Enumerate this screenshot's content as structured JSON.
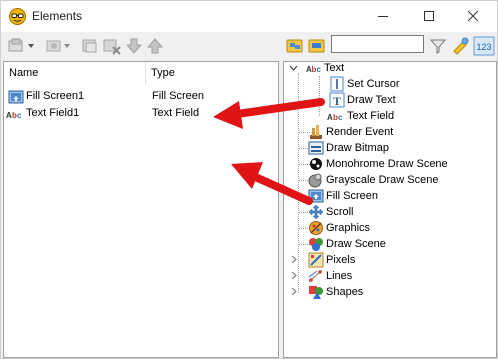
{
  "window": {
    "title": "Elements",
    "controls": {
      "minimize": "minimize",
      "maximize": "maximize",
      "close": "close"
    }
  },
  "toolbar_left": {
    "icons": [
      "add-element-icon",
      "add-dropdown-icon",
      "duplicate-icon",
      "delete-icon",
      "move-down-icon",
      "move-up-icon"
    ]
  },
  "toolbar_right": {
    "search": {
      "value": "",
      "placeholder": ""
    },
    "icons": [
      "expand-all-icon",
      "collapse-all-icon",
      "clear-filter-icon",
      "settings-icon",
      "sort-numeric-icon"
    ]
  },
  "elements_list": {
    "columns": [
      "Name",
      "Type"
    ],
    "rows": [
      {
        "name": "Fill Screen1",
        "type": "Fill Screen",
        "icon": "fill-screen-icon"
      },
      {
        "name": "Text Field1",
        "type": "Text Field",
        "icon": "text-field-icon"
      }
    ]
  },
  "tree": {
    "items": [
      {
        "label": "Text",
        "icon": "text-icon",
        "expanded": true
      },
      {
        "label": "Set Cursor",
        "icon": "set-cursor-icon"
      },
      {
        "label": "Draw Text",
        "icon": "draw-text-icon"
      },
      {
        "label": "Text Field",
        "icon": "text-field-icon"
      },
      {
        "label": "Render Event",
        "icon": "render-event-icon"
      },
      {
        "label": "Draw Bitmap",
        "icon": "draw-bitmap-icon"
      },
      {
        "label": "Monohrome Draw Scene",
        "icon": "monochrome-scene-icon"
      },
      {
        "label": "Grayscale Draw Scene",
        "icon": "grayscale-scene-icon"
      },
      {
        "label": "Fill Screen",
        "icon": "fill-screen-icon"
      },
      {
        "label": "Scroll",
        "icon": "scroll-icon"
      },
      {
        "label": "Graphics",
        "icon": "graphics-icon"
      },
      {
        "label": "Draw Scene",
        "icon": "draw-scene-icon"
      },
      {
        "label": "Pixels",
        "icon": "pixels-icon",
        "expanded": false
      },
      {
        "label": "Lines",
        "icon": "lines-icon",
        "expanded": false
      },
      {
        "label": "Shapes",
        "icon": "shapes-icon",
        "expanded": false
      }
    ]
  },
  "colors": {
    "annotation_arrow": "#e01414",
    "panel_border": "#a0a0a0",
    "window_bg": "#f0f0f0"
  }
}
